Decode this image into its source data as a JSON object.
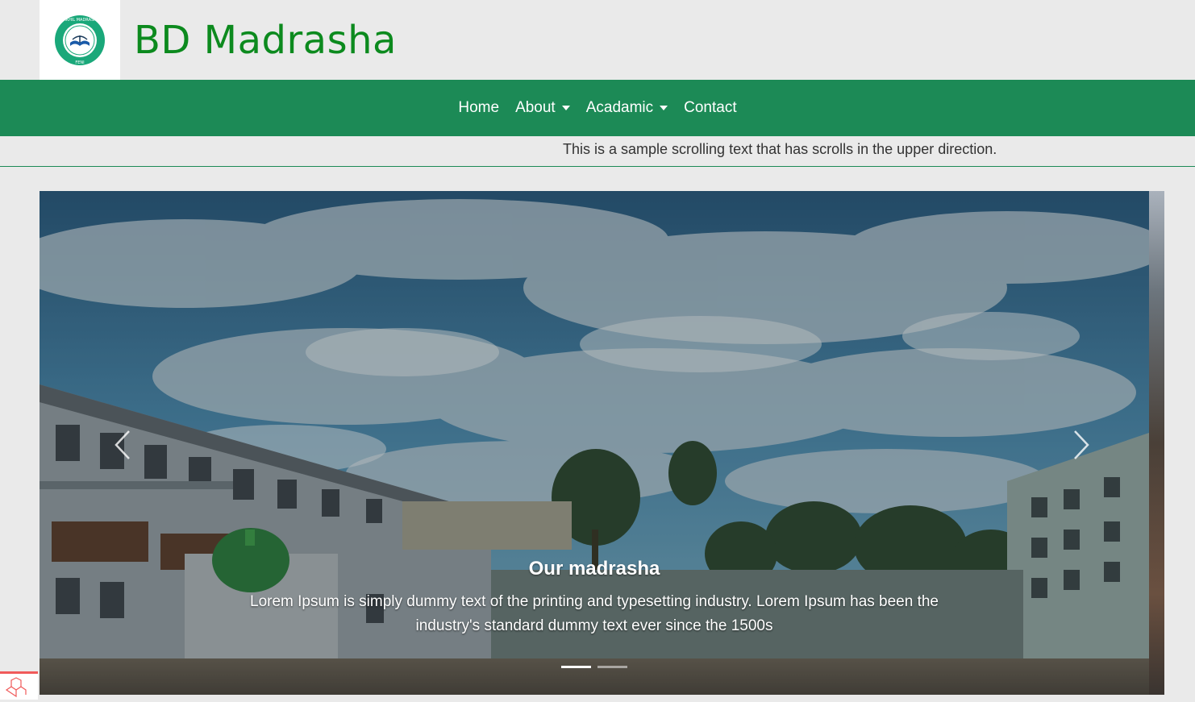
{
  "header": {
    "title": "BD Madrasha",
    "logo": {
      "icon": "madrasha-seal-logo",
      "ring_text": "DAKHIL MADRASHA",
      "bottom_text": "FENI"
    }
  },
  "nav": {
    "items": [
      {
        "label": "Home",
        "dropdown": false
      },
      {
        "label": "About",
        "dropdown": true
      },
      {
        "label": "Acadamic",
        "dropdown": true
      },
      {
        "label": "Contact",
        "dropdown": false
      }
    ]
  },
  "ticker": {
    "text": "This is a sample scrolling text that has scrolls in the upper direction."
  },
  "carousel": {
    "caption_title": "Our madrasha",
    "caption_text": "Lorem Ipsum is simply dummy text of the printing and typesetting industry. Lorem Ipsum has been the industry's standard dummy text ever since the 1500s",
    "indicators": [
      {
        "active": true
      },
      {
        "active": false
      }
    ],
    "prev_icon": "chevron-left-icon",
    "next_icon": "chevron-right-icon"
  },
  "colors": {
    "brand_green": "#1c8a56",
    "title_green": "#0c8a1e",
    "background": "#eaeaea"
  }
}
